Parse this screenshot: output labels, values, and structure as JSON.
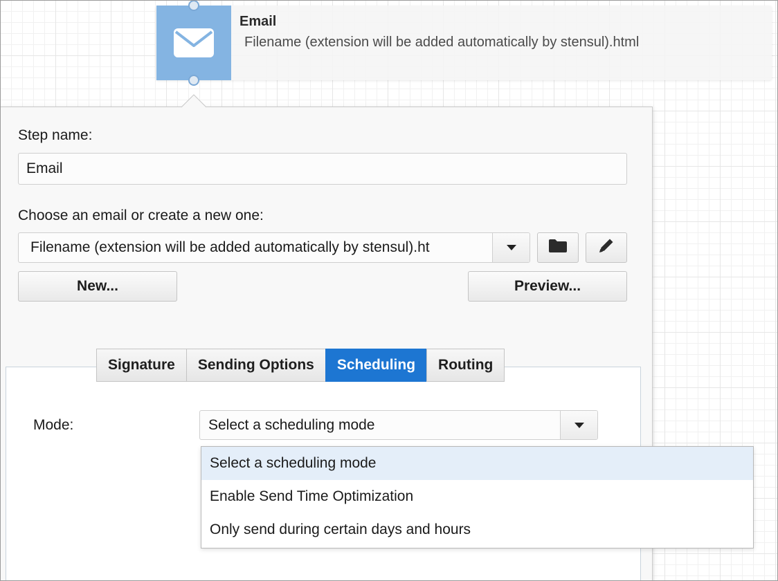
{
  "node": {
    "title": "Email",
    "subtitle": "Filename (extension will be added automatically by stensul).html",
    "icon": "envelope-icon",
    "icon_bg_color": "#84b4e2"
  },
  "form": {
    "step_name_label": "Step name:",
    "step_name_value": "Email",
    "choose_label": "Choose an email or create a new one:",
    "email_select_value": "Filename (extension will be added automatically by stensul).ht",
    "folder_icon": "folder-icon",
    "edit_icon": "pencil-icon",
    "new_button": "New...",
    "preview_button": "Preview..."
  },
  "tabs": [
    {
      "label": "Signature",
      "active": false
    },
    {
      "label": "Sending Options",
      "active": false
    },
    {
      "label": "Scheduling",
      "active": true
    },
    {
      "label": "Routing",
      "active": false
    }
  ],
  "scheduling": {
    "mode_label": "Mode:",
    "mode_value": "Select a scheduling mode",
    "options": [
      "Select a scheduling mode",
      "Enable Send Time Optimization",
      "Only send during certain days and hours"
    ]
  },
  "colors": {
    "active_tab": "#1d76d2",
    "highlight_row": "#e4eef9"
  }
}
